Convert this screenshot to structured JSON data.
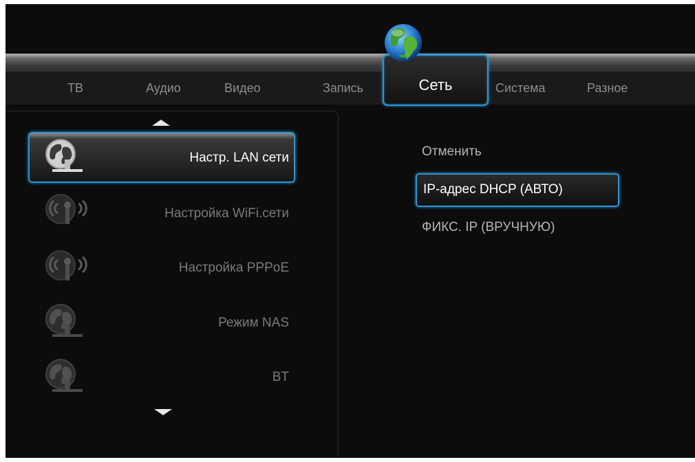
{
  "tabs": [
    {
      "label": "ТВ"
    },
    {
      "label": "Аудио"
    },
    {
      "label": "Видео"
    },
    {
      "label": "Запись"
    },
    {
      "label": "Сеть",
      "active": true
    },
    {
      "label": "Система"
    },
    {
      "label": "Разное"
    }
  ],
  "menu": {
    "items": [
      {
        "label": "Настр. LAN сети",
        "icon": "network-globe-icon",
        "selected": true
      },
      {
        "label": "Настройка WiFi.сети",
        "icon": "wifi-antenna-icon"
      },
      {
        "label": "Настройка PPPoE",
        "icon": "wifi-antenna-icon"
      },
      {
        "label": "Режим NAS",
        "icon": "network-globe-icon"
      },
      {
        "label": "BT",
        "icon": "network-globe-icon"
      }
    ]
  },
  "options": {
    "items": [
      {
        "label": "Отменить"
      },
      {
        "label": "IP-адрес DHCP (АВТО)",
        "selected": true
      },
      {
        "label": "ФИКС. IP (ВРУЧНУЮ)"
      }
    ]
  },
  "colors": {
    "accent": "#2f95cc",
    "background": "#0c0c0c"
  }
}
